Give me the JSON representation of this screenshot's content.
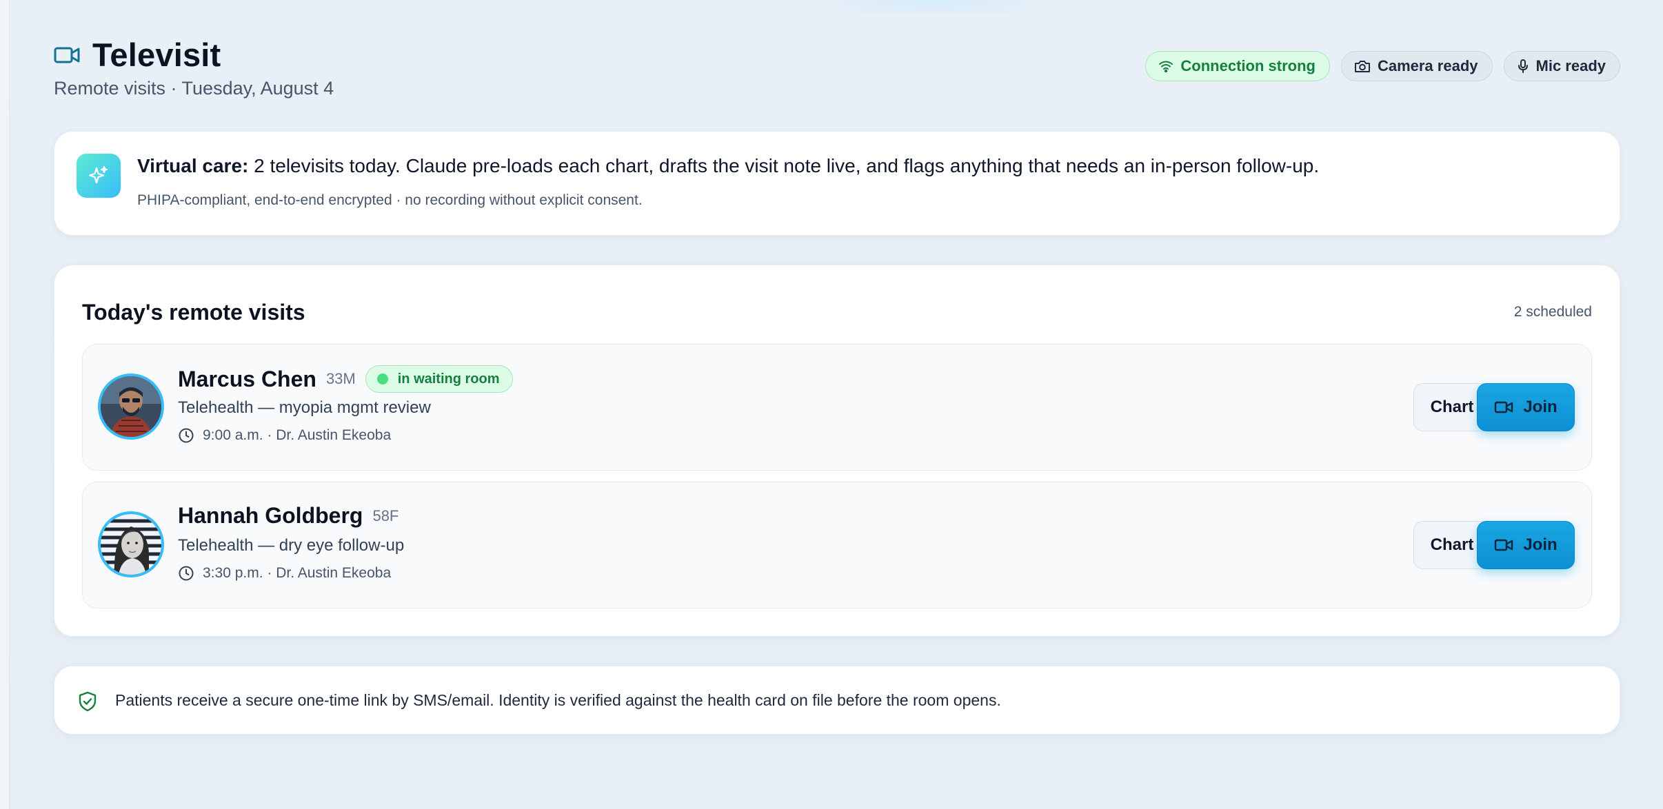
{
  "header": {
    "title": "Televisit",
    "subtitle": "Remote visits · Tuesday, August 4",
    "title_icon": "video-camera-icon"
  },
  "status": [
    {
      "label": "Connection strong",
      "icon": "wifi-icon",
      "tone": "good",
      "color": "#15803d"
    },
    {
      "label": "Camera ready",
      "icon": "camera-icon",
      "tone": "neutral"
    },
    {
      "label": "Mic ready",
      "icon": "mic-icon",
      "tone": "neutral"
    }
  ],
  "ai_banner": {
    "icon": "sparkles-icon",
    "lead": "Virtual care:",
    "text": " 2 televisits today. Claude pre-loads each chart, drafts the visit note live, and flags anything that needs an in-person follow-up.",
    "subtext": "PHIPA-compliant, end-to-end encrypted · no recording without explicit consent."
  },
  "visits_section": {
    "title": "Today's remote visits",
    "count": "2 scheduled"
  },
  "visits": [
    {
      "name": "Marcus Chen",
      "demographics": "33M",
      "status_badge": "in waiting room",
      "type": "Telehealth — myopia mgmt review",
      "time_provider": "9:00 a.m. · Dr. Austin Ekeoba",
      "chart_label": "Chart",
      "join_label": "Join"
    },
    {
      "name": "Hannah Goldberg",
      "demographics": "58F",
      "status_badge": "",
      "type": "Telehealth — dry eye follow-up",
      "time_provider": "3:30 p.m. · Dr. Austin Ekeoba",
      "chart_label": "Chart",
      "join_label": "Join"
    }
  ],
  "security_note": {
    "icon": "shield-check-icon",
    "text": "Patients receive a secure one-time link by SMS/email. Identity is verified against the health card on file before the room opens."
  },
  "colors": {
    "accent": "#0ea5e9",
    "good": "#15803d",
    "background": "#e8eef6"
  }
}
